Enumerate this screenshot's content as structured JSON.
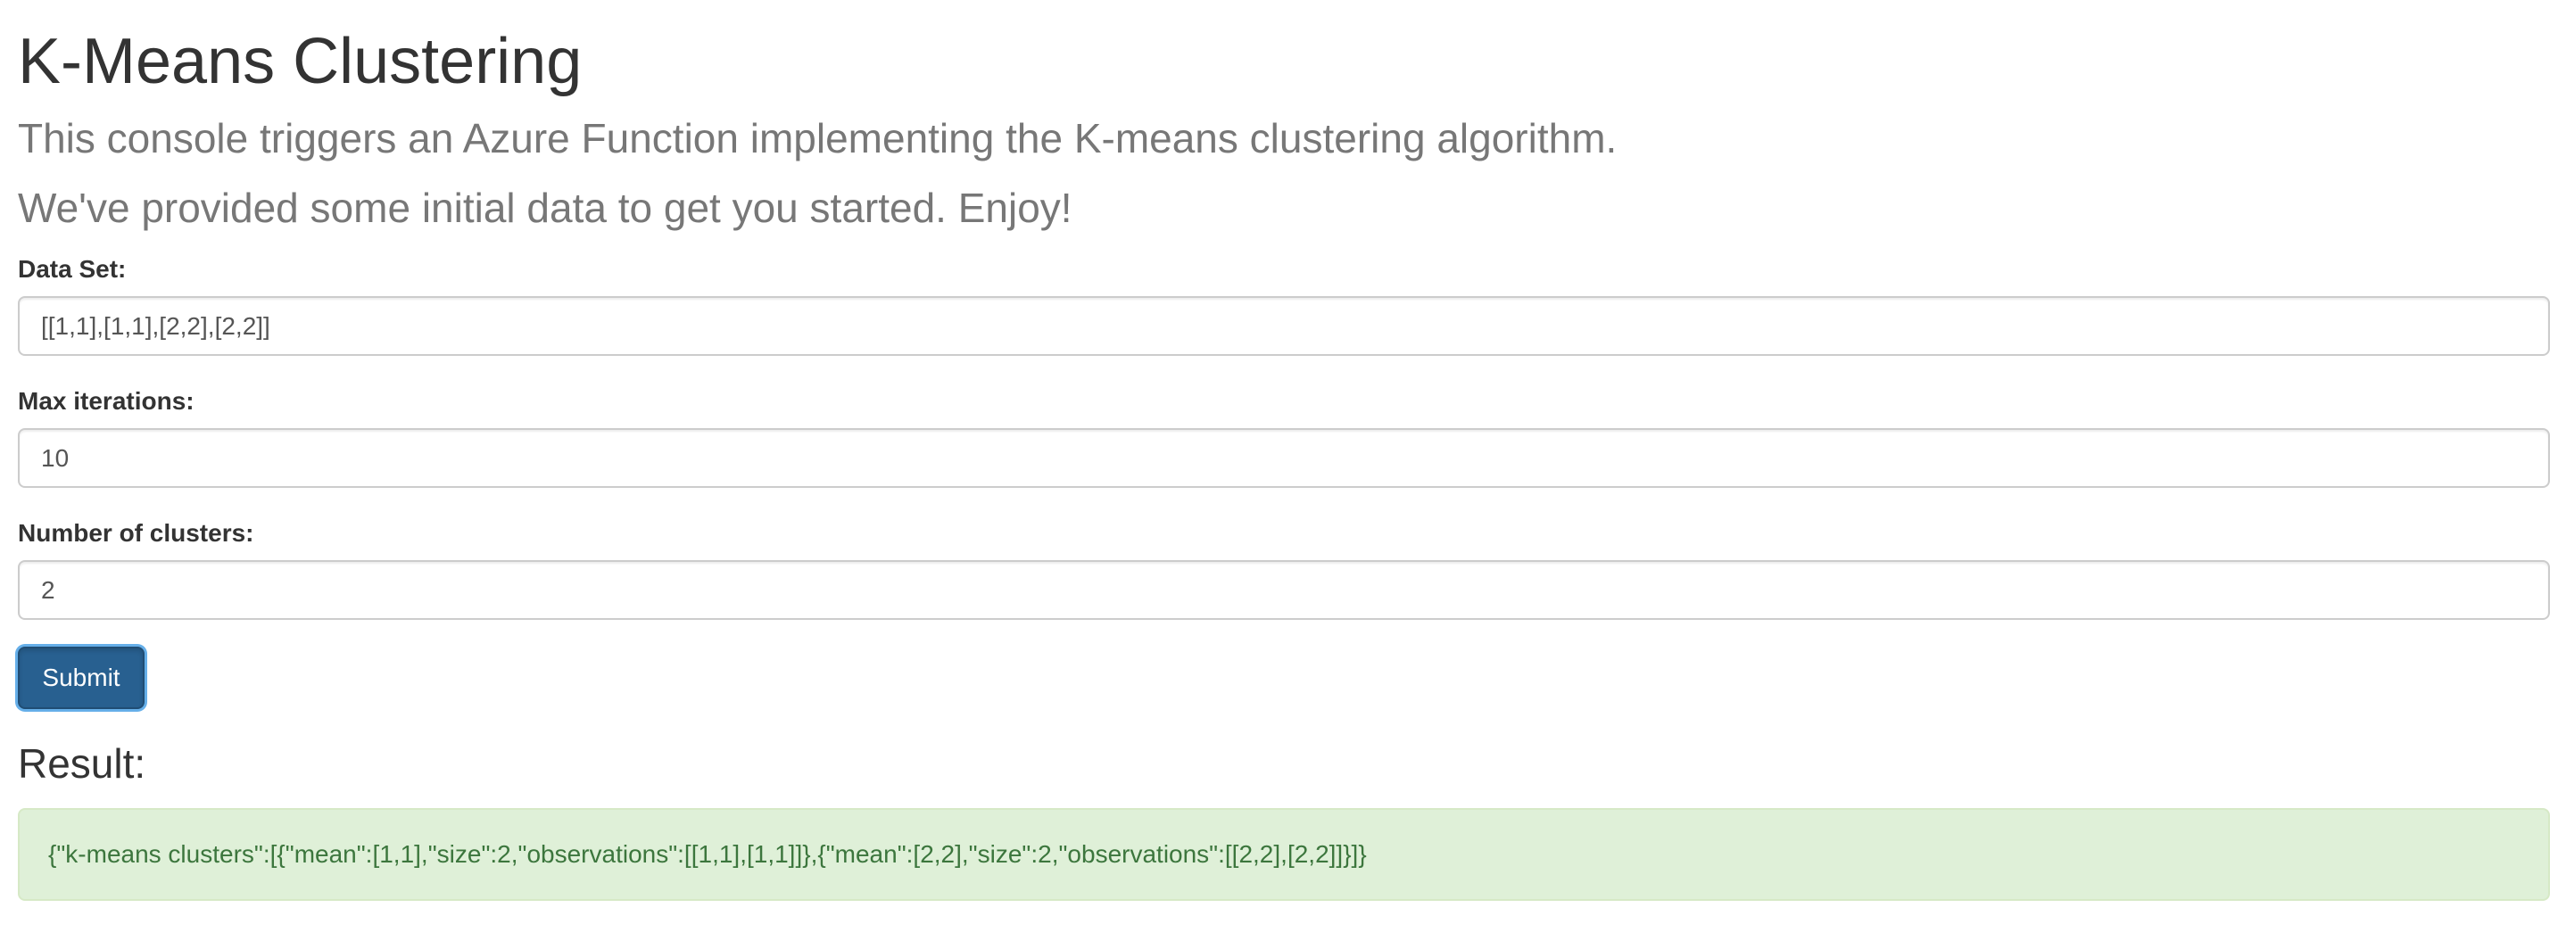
{
  "header": {
    "title": "K-Means Clustering",
    "lead_1": "This console triggers an Azure Function implementing the K-means clustering algorithm.",
    "lead_2": "We've provided some initial data to get you started. Enjoy!"
  },
  "form": {
    "dataset": {
      "label": "Data Set:",
      "value": "[[1,1],[1,1],[2,2],[2,2]]"
    },
    "max_iterations": {
      "label": "Max iterations:",
      "value": "10"
    },
    "clusters": {
      "label": "Number of clusters:",
      "value": "2"
    },
    "submit_label": "Submit"
  },
  "result": {
    "heading": "Result:",
    "text": "{\"k-means clusters\":[{\"mean\":[1,1],\"size\":2,\"observations\":[[1,1],[1,1]]},{\"mean\":[2,2],\"size\":2,\"observations\":[[2,2],[2,2]]}]}"
  },
  "colors": {
    "primary_button": "#286090",
    "success_bg": "#dff0d8",
    "success_text": "#3c763d"
  }
}
